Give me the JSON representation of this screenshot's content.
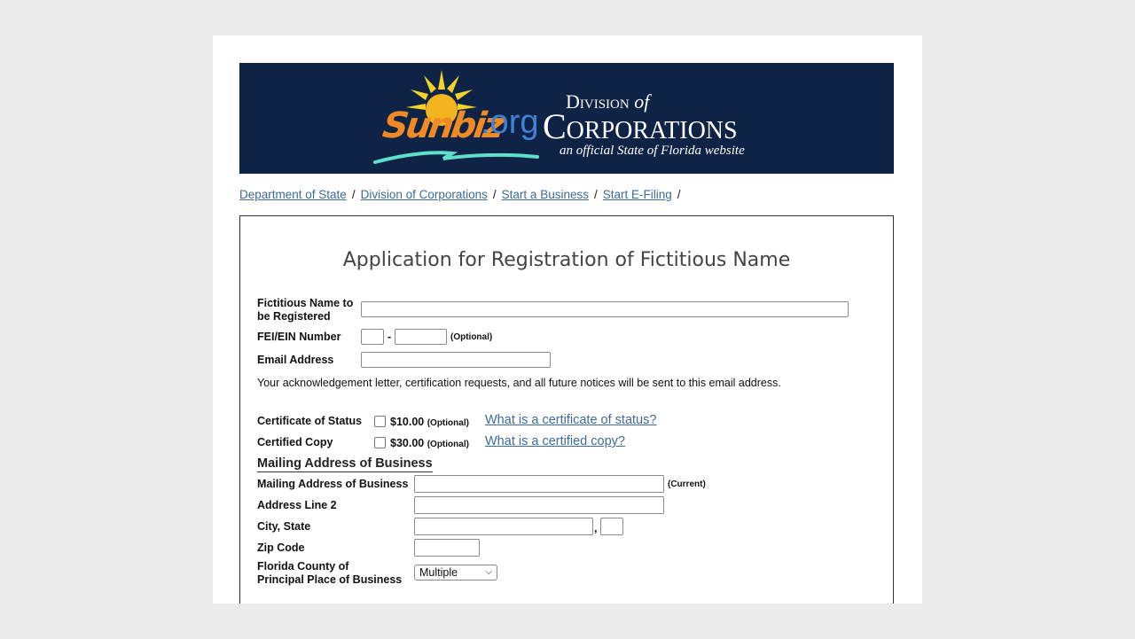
{
  "banner": {
    "logo_main": "Sunbiz",
    "logo_tld": ".org",
    "division_prefix": "Division",
    "division_of": "of",
    "division_name": "Corporations",
    "tagline": "an official State of Florida website",
    "colors": {
      "background": "#0e2346",
      "logo_orange": "#f08a24",
      "logo_blue": "#3f82d8",
      "sun": "#f5d22a",
      "wave": "#5fe0c8"
    }
  },
  "breadcrumb": {
    "items": [
      "Department of State",
      "Division of Corporations",
      "Start a Business",
      "Start E-Filing"
    ],
    "separator": "/"
  },
  "form": {
    "title": "Application for Registration of Fictitious Name",
    "fictitious_name": {
      "label_line1": "Fictitious Name to",
      "label_line2": "be Registered",
      "value": ""
    },
    "fei_ein": {
      "label": "FEI/EIN Number",
      "dash": "-",
      "part1": "",
      "part2": "",
      "note": "(Optional)"
    },
    "email": {
      "label": "Email Address",
      "value": ""
    },
    "email_note": "Your acknowledgement letter, certification requests, and all future notices will be sent to this email address.",
    "certificate_of_status": {
      "label": "Certificate of Status",
      "checked": false,
      "price": "$10.00",
      "note": "(Optional)",
      "help_link": "What is a certificate of status?"
    },
    "certified_copy": {
      "label": "Certified Copy",
      "checked": false,
      "price": "$30.00",
      "note": "(Optional)",
      "help_link": "What is a certified copy?"
    },
    "mailing_section_title": "Mailing Address of Business",
    "mailing_address": {
      "label": "Mailing Address of Business",
      "value": "",
      "note": "(Current)"
    },
    "address_line2": {
      "label": "Address Line 2",
      "value": ""
    },
    "city_state": {
      "label": "City, State",
      "city": "",
      "comma": ",",
      "state": ""
    },
    "zip": {
      "label": "Zip Code",
      "value": ""
    },
    "county": {
      "label_line1": "Florida County of",
      "label_line2": "Principal Place of Business",
      "selected": "Multiple"
    }
  }
}
